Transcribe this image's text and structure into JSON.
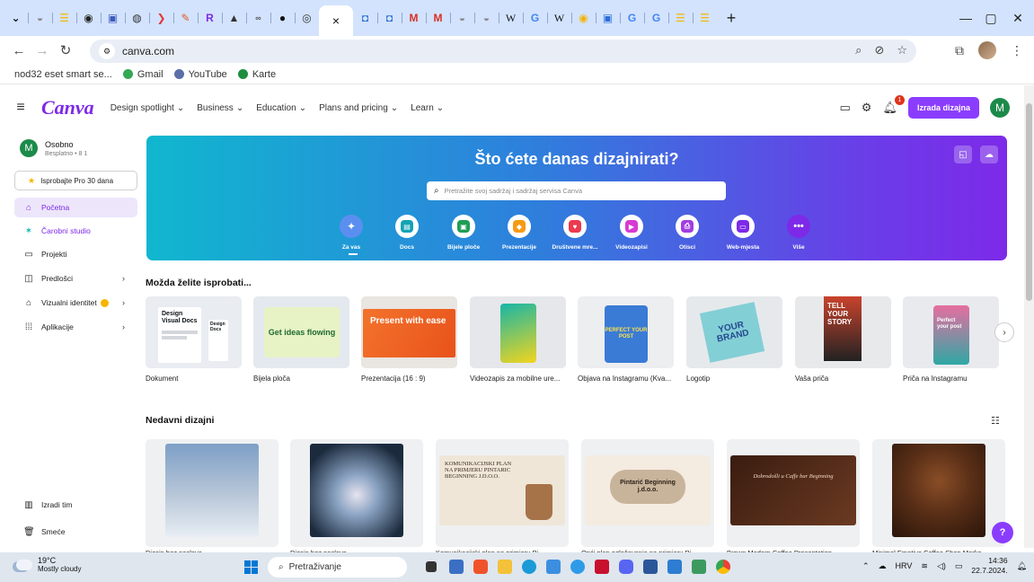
{
  "browser": {
    "url": "canva.com",
    "bookmarks": [
      "nod32 eset smart se...",
      "Gmail",
      "YouTube",
      "Karte"
    ],
    "tabs": [
      "M",
      "M",
      "W",
      "G",
      "W",
      "G",
      "G"
    ]
  },
  "header": {
    "logo": "Canva",
    "nav": [
      "Design spotlight",
      "Business",
      "Education",
      "Plans and pricing",
      "Learn"
    ],
    "notification_count": "1",
    "create_button": "Izrada dizajna",
    "avatar_letter": "M"
  },
  "sidebar": {
    "account_name": "Osobno",
    "account_sub": "Besplatno • 8 1",
    "avatar_letter": "M",
    "pro_button": "Isprobajte Pro 30 dana",
    "items": [
      "Početna",
      "Čarobni studio",
      "Projekti",
      "Predlošci",
      "Vizualni identitet",
      "Aplikacije"
    ],
    "bottom_items": [
      "Izradi tim",
      "Smeće"
    ]
  },
  "hero": {
    "title": "Što ćete danas dizajnirati?",
    "search_placeholder": "Pretražite svoj sadržaj i sadržaj servisa Canva",
    "categories": [
      "Za vas",
      "Docs",
      "Bijele ploče",
      "Prezentacije",
      "Društvene mre...",
      "Videozapisi",
      "Otisci",
      "Web-mjesta",
      "Više"
    ]
  },
  "suggestions": {
    "title": "Možda želite isprobati...",
    "items": [
      "Dokument",
      "Bijela ploča",
      "Prezentacija (16 : 9)",
      "Videozapis za mobilne ure...",
      "Objava na Instagramu (Kva...",
      "Logotip",
      "Vaša priča",
      "Priča na Instagramu"
    ],
    "thumb_text": {
      "doc": "Design Visual Docs",
      "doc_mini": "Design Docs",
      "whiteboard": "Get ideas flowing",
      "presentation": "Present with ease",
      "instagram": "PERFECT YOUR POST",
      "logo": "YOUR BRAND",
      "story": "TELL YOUR STORY",
      "ig_story": "Perfect your post"
    }
  },
  "recent": {
    "title": "Nedavni dizajni",
    "items": [
      "Dizajn bez naslova",
      "Dizajn bez naslova",
      "Komunikacijski plan na primjeru Pi...",
      "Opći plan oglašavanja na primjeru Pi...",
      "Brown Modern Coffee Presentation",
      "Minimal Emotive Coffee Shop Marke..."
    ],
    "thumb_text": {
      "komunikacijski": "KOMUNIKACIJSKI PLAN NA PRIMJERU PINTARIC BEGINNING J.D.O.O.",
      "pintaric": "Pintarić Beginning j.d.o.o.",
      "coffee": "Dobrodošli u Caffe bar Beginning"
    },
    "help": "?"
  },
  "taskbar": {
    "temp": "19°C",
    "weather": "Mostly cloudy",
    "search": "Pretraživanje",
    "lang": "HRV",
    "time": "14:36",
    "date": "22.7.2024."
  }
}
